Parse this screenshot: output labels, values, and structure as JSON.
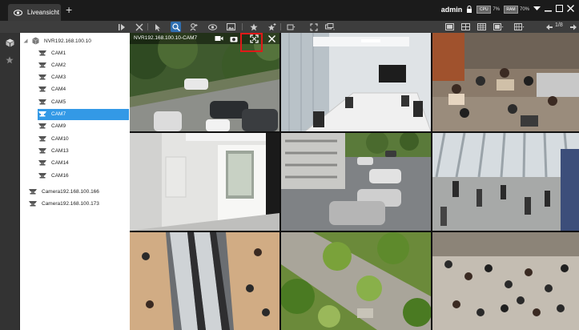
{
  "window": {
    "tab_label": "Liveansicht",
    "user": "admin",
    "cpu_label": "CPU",
    "cpu_value": "7%",
    "ram_label": "RAM",
    "ram_value": "70%"
  },
  "toolbar": {
    "page_indicator": "1/8",
    "buttons": [
      "play-icon",
      "close-all-icon",
      "pointer-icon",
      "zoom-icon",
      "ptz-icon",
      "view-icon",
      "image-icon",
      "favorite-icon",
      "favorite-add-icon",
      "repeat-icon",
      "fullscreen-icon",
      "screens-icon",
      "layout-1-icon",
      "layout-4-icon",
      "layout-9-icon",
      "layout-custom-icon",
      "layout-more-icon",
      "prev-page-icon",
      "next-page-icon"
    ]
  },
  "tree": {
    "nvr": "NVR192.168.100.10",
    "cameras": [
      {
        "label": "CAM1",
        "selected": false
      },
      {
        "label": "CAM2",
        "selected": false
      },
      {
        "label": "CAM3",
        "selected": false
      },
      {
        "label": "CAM4",
        "selected": false
      },
      {
        "label": "CAM5",
        "selected": false
      },
      {
        "label": "CAM7",
        "selected": true
      },
      {
        "label": "CAM9",
        "selected": false
      },
      {
        "label": "CAM10",
        "selected": false
      },
      {
        "label": "CAM13",
        "selected": false
      },
      {
        "label": "CAM14",
        "selected": false
      },
      {
        "label": "CAM16",
        "selected": false
      }
    ],
    "standalone": [
      "Camera192.168.100.166",
      "Camera192.168.100.173"
    ]
  },
  "grid": {
    "active_cell_caption": "NVR192.168.100.10-CAM7",
    "cells": [
      {
        "scene": "park-street"
      },
      {
        "scene": "meeting-room"
      },
      {
        "scene": "cafeteria"
      },
      {
        "scene": "office-door"
      },
      {
        "scene": "parking-lot"
      },
      {
        "scene": "airport-hall"
      },
      {
        "scene": "escalators"
      },
      {
        "scene": "garden-aerial"
      },
      {
        "scene": "crowd-plaza"
      }
    ]
  },
  "colors": {
    "selection": "#3399e6",
    "highlight_box": "#e01919",
    "active_tool": "#2f6fb0"
  }
}
